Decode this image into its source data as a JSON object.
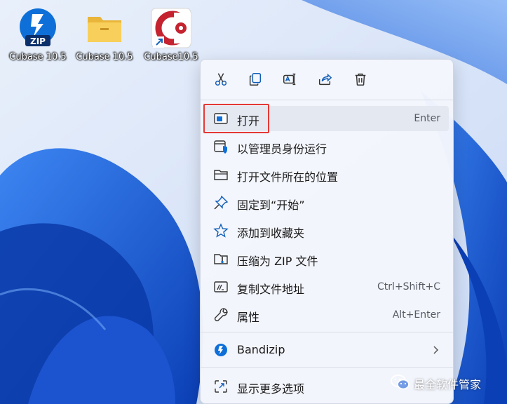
{
  "desktop": {
    "icons": [
      {
        "label": "Cubase 10.5",
        "icon": "zip-icon",
        "badge": "ZIP"
      },
      {
        "label": "Cubase 10.5",
        "icon": "folder-icon"
      },
      {
        "label": "Cubase10.5",
        "icon": "cubase-app-icon"
      }
    ]
  },
  "context_menu": {
    "quick_actions": [
      "cut-icon",
      "copy-icon",
      "rename-icon",
      "share-icon",
      "delete-icon"
    ],
    "items": [
      {
        "label": "打开",
        "shortcut": "Enter",
        "icon": "open-icon",
        "highlighted": true
      },
      {
        "label": "以管理员身份运行",
        "icon": "run-as-admin-icon"
      },
      {
        "label": "打开文件所在的位置",
        "icon": "folder-icon"
      },
      {
        "label": "固定到“开始”",
        "icon": "pin-icon"
      },
      {
        "label": "添加到收藏夹",
        "icon": "star-icon"
      },
      {
        "label": "压缩为 ZIP 文件",
        "icon": "zip-folder-icon"
      },
      {
        "label": "复制文件地址",
        "shortcut": "Ctrl+Shift+C",
        "icon": "copy-path-icon"
      },
      {
        "label": "属性",
        "shortcut": "Alt+Enter",
        "icon": "wrench-icon"
      },
      {
        "label": "Bandizip",
        "icon": "bandizip-icon",
        "submenu": true
      },
      {
        "label": "显示更多选项",
        "icon": "more-options-icon"
      }
    ]
  },
  "watermark": {
    "text": "最全软件管家",
    "icon": "wechat-icon"
  },
  "colors": {
    "highlight_border": "#e53935",
    "accent": "#0067c0",
    "wallpaper": "#1f5fd6"
  }
}
